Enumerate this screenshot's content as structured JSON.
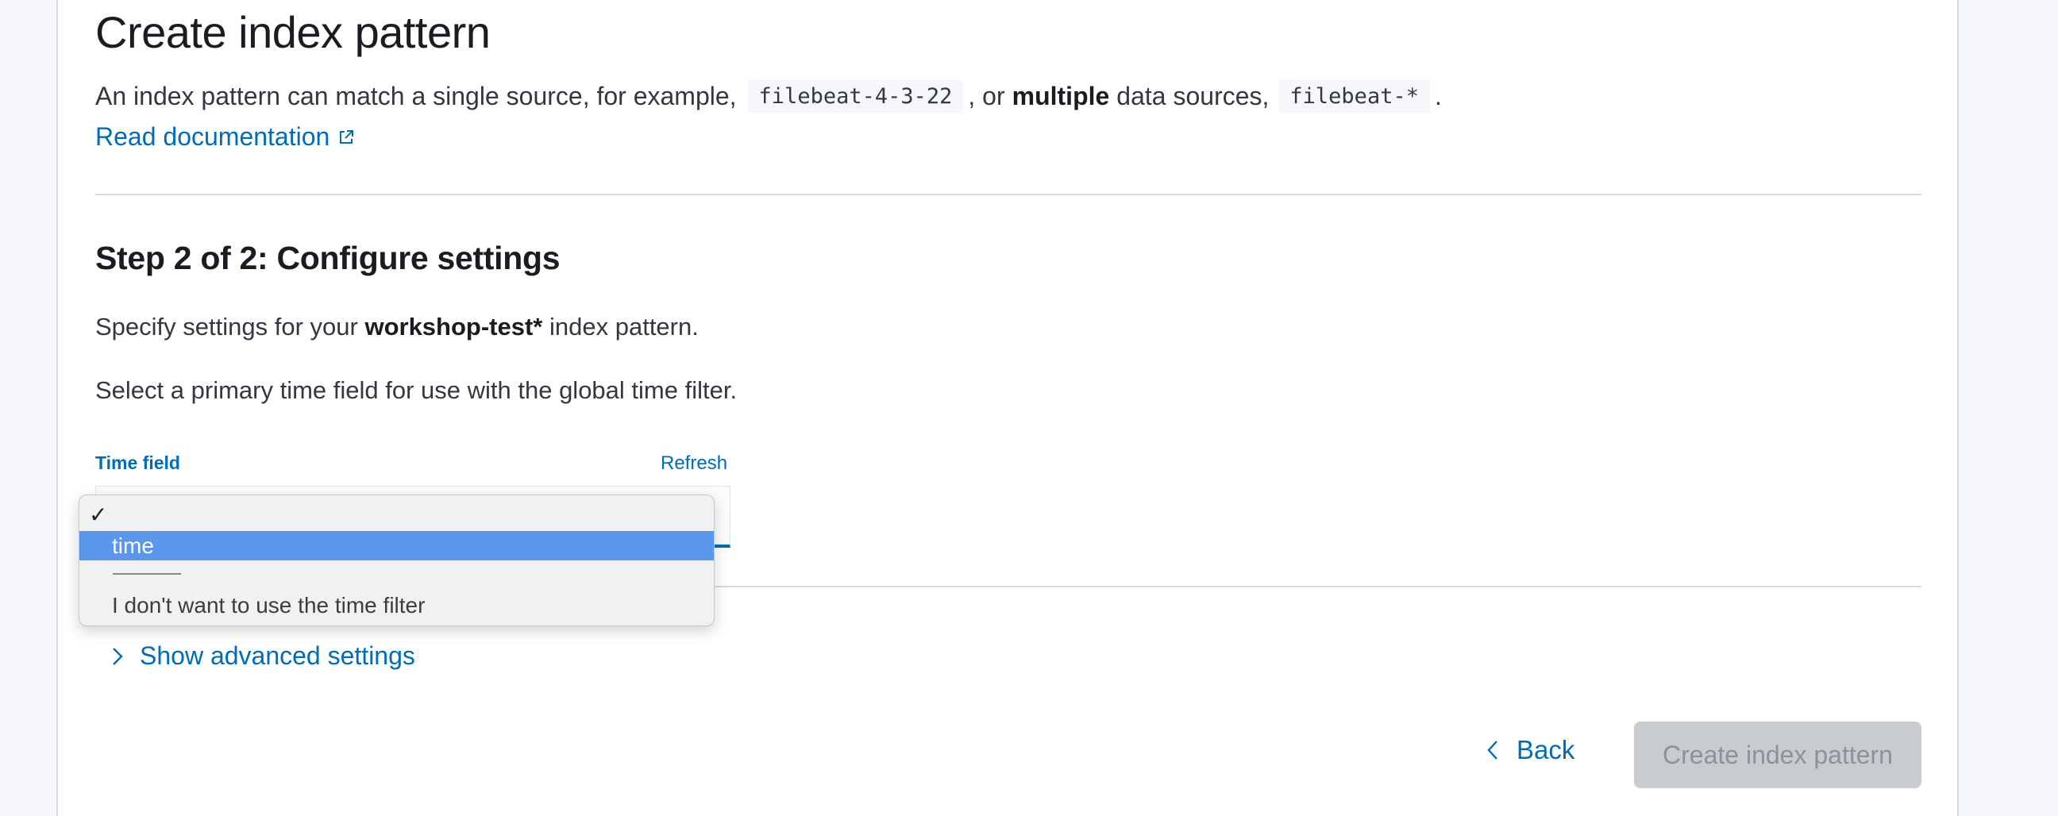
{
  "page": {
    "title": "Create index pattern",
    "description": {
      "part1": "An index pattern can match a single source, for example,",
      "example_single": "filebeat-4-3-22",
      "part2": ", or",
      "emphasis": "multiple",
      "part3": "data sources,",
      "example_multiple": "filebeat-*",
      "part4": "."
    },
    "docs_link": "Read documentation",
    "docs_icon": "external-link-icon"
  },
  "step": {
    "heading": "Step 2 of 2: Configure settings",
    "specify_prefix": "Specify settings for your",
    "pattern_name": "workshop-test*",
    "specify_suffix": "index pattern.",
    "select_text": "Select a primary time field for use with the global time filter."
  },
  "time_field": {
    "label": "Time field",
    "refresh": "Refresh",
    "options": {
      "check": "✓",
      "time": "time",
      "no_filter": "I don't want to use the time filter"
    },
    "selected": "time"
  },
  "advanced": {
    "label": "Show advanced settings",
    "icon": "chevron-right-icon"
  },
  "footer": {
    "back": "Back",
    "back_icon": "chevron-left-icon",
    "create": "Create index pattern"
  },
  "colors": {
    "link": "#006bb8",
    "highlight": "#5a96ec",
    "disabled_button": "#c8cbd0"
  }
}
